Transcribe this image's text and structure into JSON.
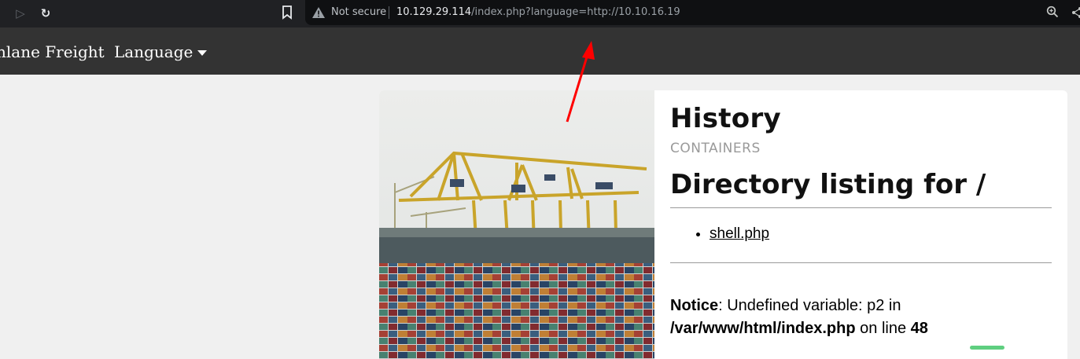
{
  "browser": {
    "security_label": "Not secure",
    "url_host": "10.129.29.114",
    "url_path": "/index.php?language=http://10.10.16.19",
    "icons": [
      "forward-icon",
      "reload-icon",
      "bookmark-icon",
      "warning-icon",
      "zoom-icon",
      "share-icon"
    ]
  },
  "site": {
    "brand": "nlane Freight",
    "nav_language": "Language"
  },
  "content": {
    "heading": "History",
    "subheading": "CONTAINERS",
    "dir_heading": "Directory listing for /",
    "files": [
      "shell.php"
    ],
    "notice_label": "Notice",
    "notice_text1": ": Undefined variable: p2 in",
    "notice_path": "/var/www/html/index.php",
    "notice_text2": " on line ",
    "notice_line": "48"
  },
  "colors": {
    "header_bg": "#333333",
    "page_bg": "#f0f0f0",
    "annotation_arrow": "#ff0000",
    "accent_green": "#5fcf80"
  }
}
